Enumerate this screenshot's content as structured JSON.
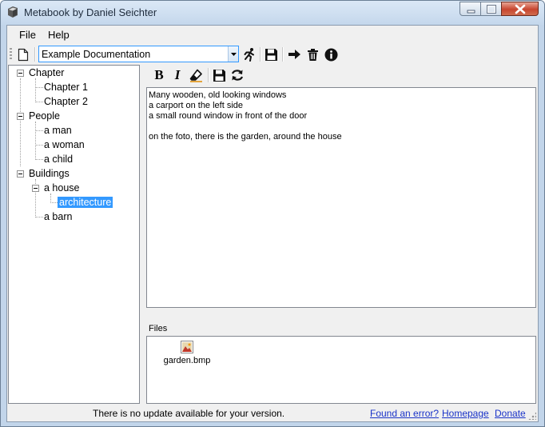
{
  "window": {
    "title": "Metabook by Daniel Seichter",
    "controls": [
      "minimize-icon",
      "maximize-icon",
      "close-icon"
    ]
  },
  "menu": {
    "items": [
      {
        "label": "File"
      },
      {
        "label": "Help"
      }
    ]
  },
  "toolbar": {
    "combo_value": "Example Documentation",
    "icons": [
      "new-document-icon",
      "run-icon",
      "save-icon",
      "arrow-right-icon",
      "trash-icon",
      "info-icon"
    ]
  },
  "tree": {
    "nodes": [
      {
        "label": "Chapter",
        "level": 0,
        "expanded": true
      },
      {
        "label": "Chapter 1",
        "level": 1
      },
      {
        "label": "Chapter 2",
        "level": 1
      },
      {
        "label": "People",
        "level": 0,
        "expanded": true
      },
      {
        "label": "a man",
        "level": 1
      },
      {
        "label": "a woman",
        "level": 1
      },
      {
        "label": "a child",
        "level": 1
      },
      {
        "label": "Buildings",
        "level": 0,
        "expanded": true
      },
      {
        "label": "a house",
        "level": 1,
        "expanded": true
      },
      {
        "label": "architecture",
        "level": 2,
        "selected": true
      },
      {
        "label": "a barn",
        "level": 1
      }
    ]
  },
  "editor": {
    "toolbar_icons": [
      "bold-icon",
      "italic-icon",
      "eraser-icon",
      "save-icon",
      "refresh-icon"
    ],
    "bold_label": "B",
    "italic_label": "I",
    "lines": [
      "Many wooden, old looking windows",
      "a carport on the left side",
      "a small round window in front of the door",
      "",
      "on the foto, there is the garden, around the house"
    ]
  },
  "files": {
    "label": "Files",
    "items": [
      {
        "name": "garden.bmp",
        "icon": "bitmap-file-icon"
      }
    ]
  },
  "status": {
    "text": "There is no update available for your version.",
    "links": [
      "Found an error?",
      "Homepage",
      "Donate"
    ]
  },
  "colors": {
    "selection": "#3399ff",
    "link": "#1a33c8",
    "title_bar": "#c4d7ec"
  }
}
